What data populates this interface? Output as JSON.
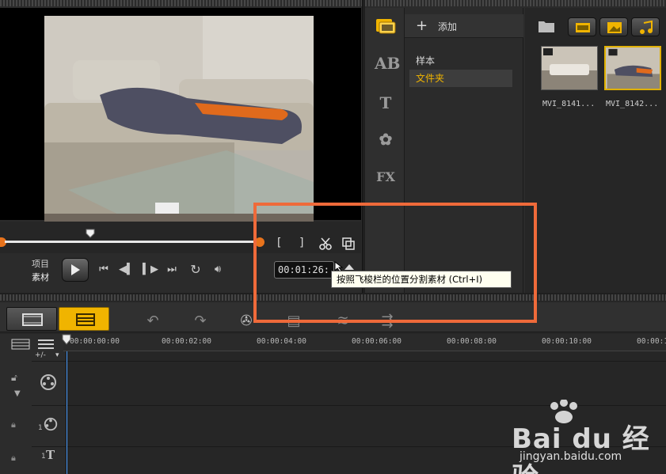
{
  "preview": {
    "mode_labels": [
      "项目",
      "素材"
    ],
    "timecode": "00:01:26:",
    "trim_in": "[",
    "trim_out": "]"
  },
  "library": {
    "add_label": "添加",
    "folders": [
      "样本",
      "文件夹"
    ],
    "selected_folder": "文件夹",
    "rail_icons": [
      "media-icon",
      "transition-icon",
      "title-icon",
      "graphic-icon",
      "filter-icon"
    ],
    "media_items": [
      {
        "label": "MVI_8141..."
      },
      {
        "label": "MVI_8142..."
      }
    ],
    "view_buttons": [
      "video-filter-icon",
      "photo-filter-icon",
      "audio-filter-icon"
    ]
  },
  "tooltip": {
    "text": "按照飞梭栏的位置分割素材 (Ctrl+I)"
  },
  "timeline": {
    "ruler_ticks": [
      "00:00:00:00",
      "00:00:02:00",
      "00:00:04:00",
      "00:00:06:00",
      "00:00:08:00",
      "00:00:10:00",
      "00:00:1"
    ],
    "track_numbers": [
      "1",
      "1"
    ],
    "zoom_label": "+/-"
  },
  "watermark": {
    "brand": "Bai du 经验",
    "url": "jingyan.baidu.com"
  },
  "colors": {
    "accent_orange": "#e8731c",
    "selection_yellow": "#f0b400",
    "highlight_red": "#ef6a3a",
    "playhead_blue": "#4ea0ff"
  }
}
